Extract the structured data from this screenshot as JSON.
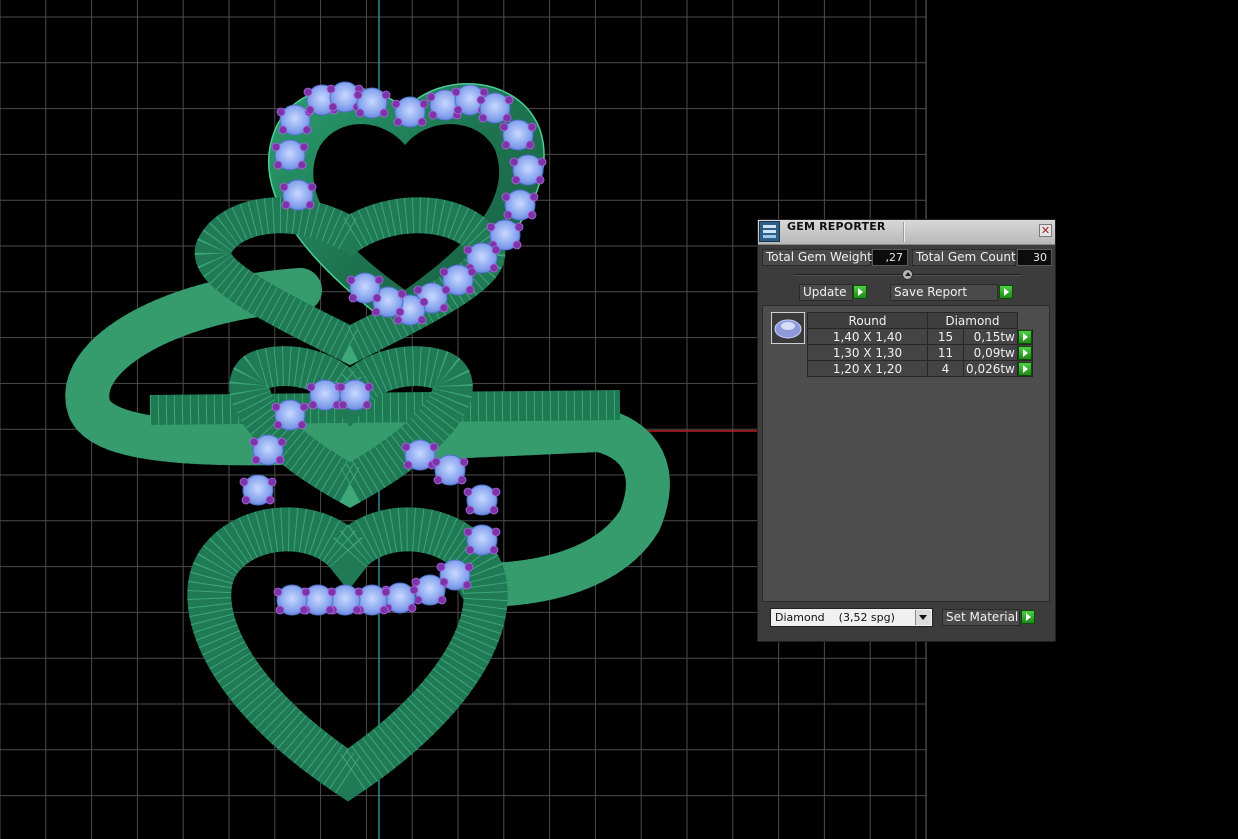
{
  "panel": {
    "title": "GEM REPORTER",
    "close_icon": "close-icon",
    "total_gem_weight_label": "Total Gem Weight",
    "total_gem_weight_value": ",27",
    "total_gem_count_label": "Total Gem Count",
    "total_gem_count_value": "30",
    "update_label": "Update",
    "save_report_label": "Save Report",
    "table": {
      "shape_header": "Round",
      "material_header": "Diamond",
      "rows": [
        {
          "size": "1,40 X 1,40",
          "count": "15",
          "weight": "0,15tw"
        },
        {
          "size": "1,30 X 1,30",
          "count": "11",
          "weight": "0,09tw"
        },
        {
          "size": "1,20 X 1,20",
          "count": "4",
          "weight": "0,026tw"
        }
      ]
    },
    "material_value": "Diamond    (3,52 spg)",
    "set_material_label": "Set Material"
  },
  "colors": {
    "background": "#000000",
    "grid": "#6e6e6e",
    "axis_vertical": "#2f8a92",
    "axis_horizontal": "#c01f1f",
    "metal": "#1f7a55",
    "metal_wire": "#49c08a",
    "gem": "#8fb0f2",
    "prong": "#7a3aa8",
    "go_button": "#2fae28"
  }
}
